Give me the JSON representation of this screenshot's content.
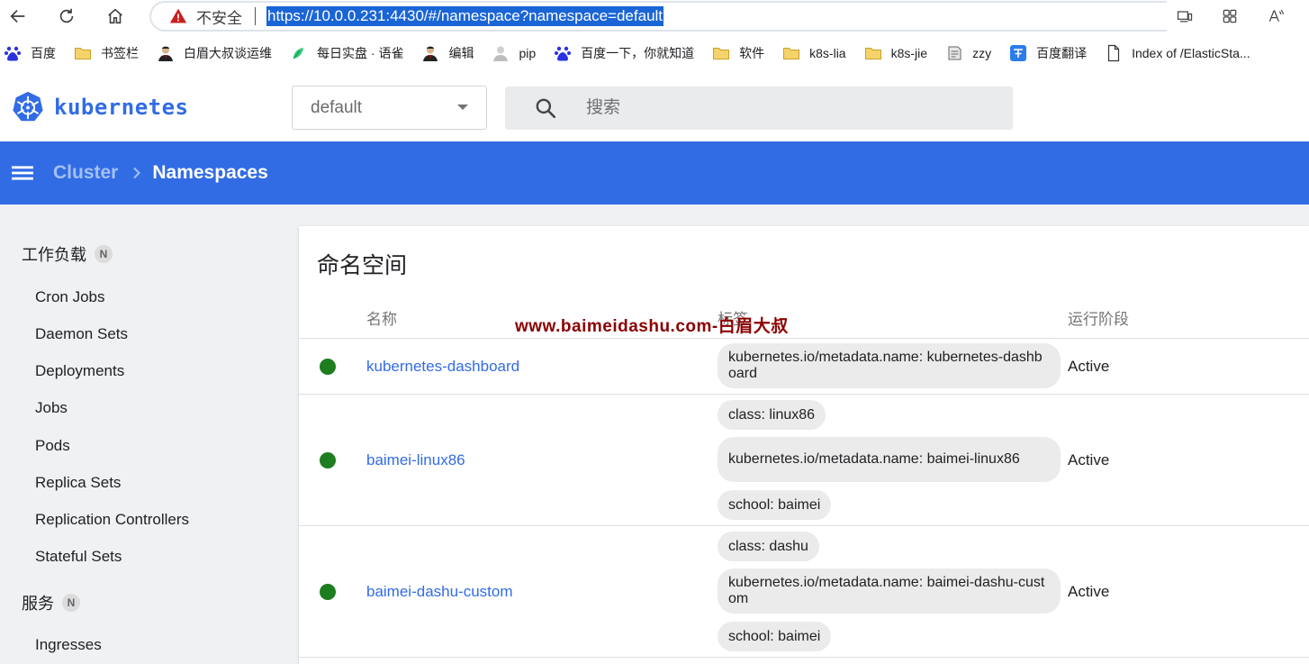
{
  "browser": {
    "not_secure": "不安全",
    "url": "https://10.0.0.231:4430/#/namespace?namespace=default"
  },
  "bookmarks": [
    {
      "label": "百度",
      "icon": "baidu-paw-icon"
    },
    {
      "label": "书签栏",
      "icon": "folder-icon"
    },
    {
      "label": "白眉大叔谈运维",
      "icon": "avatar-icon"
    },
    {
      "label": "每日实盘 · 语雀",
      "icon": "yuque-icon"
    },
    {
      "label": "编辑",
      "icon": "avatar-icon"
    },
    {
      "label": "pip",
      "icon": "avatar-gray-icon"
    },
    {
      "label": "百度一下，你就知道",
      "icon": "baidu-paw-icon"
    },
    {
      "label": "软件",
      "icon": "folder-icon"
    },
    {
      "label": "k8s-lia",
      "icon": "folder-icon"
    },
    {
      "label": "k8s-jie",
      "icon": "folder-icon"
    },
    {
      "label": "zzy",
      "icon": "note-icon"
    },
    {
      "label": "百度翻译",
      "icon": "translate-icon"
    },
    {
      "label": "Index of /ElasticSta...",
      "icon": "file-icon"
    }
  ],
  "header": {
    "logo_text": "kubernetes",
    "namespace_value": "default",
    "search_placeholder": "搜索"
  },
  "toolbar": {
    "parent": "Cluster",
    "current": "Namespaces"
  },
  "sidebar": {
    "groups": [
      {
        "label": "工作负载",
        "badge": "N",
        "items": [
          "Cron Jobs",
          "Daemon Sets",
          "Deployments",
          "Jobs",
          "Pods",
          "Replica Sets",
          "Replication Controllers",
          "Stateful Sets"
        ]
      },
      {
        "label": "服务",
        "badge": "N",
        "items": [
          "Ingresses"
        ]
      }
    ]
  },
  "card": {
    "title": "命名空间",
    "columns": {
      "name": "名称",
      "labels": "标签",
      "phase": "运行阶段"
    },
    "watermark": "www.baimeidashu.com-白眉大叔",
    "rows": [
      {
        "name": "kubernetes-dashboard",
        "labels": [
          "kubernetes.io/metadata.name: kubernetes-dashboard"
        ],
        "phase": "Active"
      },
      {
        "name": "baimei-linux86",
        "labels": [
          "class: linux86",
          "kubernetes.io/metadata.name: baimei-linux86",
          "school: baimei"
        ],
        "phase": "Active"
      },
      {
        "name": "baimei-dashu-custom",
        "labels": [
          "class: dashu",
          "kubernetes.io/metadata.name: baimei-dashu-custom",
          "school: baimei"
        ],
        "phase": "Active"
      }
    ]
  },
  "colors": {
    "brand": "#326ce5",
    "status_ok": "#1e7d1e",
    "watermark": "#8b0000"
  }
}
